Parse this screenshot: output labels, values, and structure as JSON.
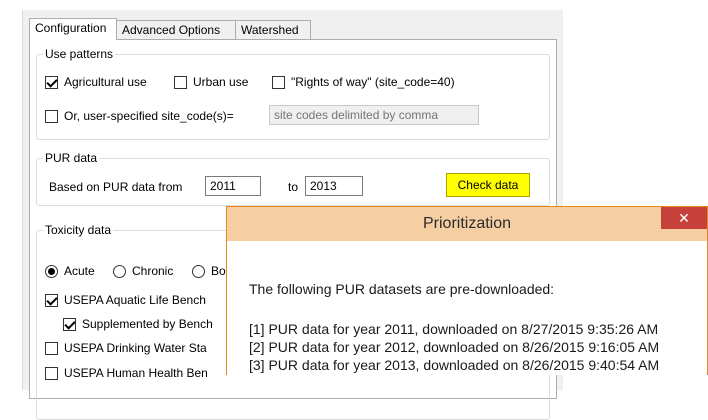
{
  "tabs": [
    {
      "label": "Configuration",
      "active": true
    },
    {
      "label": "Advanced Options",
      "active": false
    },
    {
      "label": "Watershed",
      "active": false
    }
  ],
  "use_patterns": {
    "title": "Use patterns",
    "agricultural": {
      "label": "Agricultural use",
      "checked": true
    },
    "urban": {
      "label": "Urban use",
      "checked": false
    },
    "rights_of_way": {
      "label": "\"Rights of way\" (site_code=40)",
      "checked": false
    },
    "user_specified": {
      "label": "Or, user-specified site_code(s)=",
      "checked": false
    },
    "site_codes_placeholder": "site codes delimited by comma"
  },
  "pur_data": {
    "title": "PUR data",
    "based_on_label": "Based on PUR data from",
    "from_year": "2011",
    "to_label": "to",
    "to_year": "2013",
    "check_button": "Check data",
    "check_button_color": "#ffff00"
  },
  "toxicity": {
    "title": "Toxicity data",
    "radio_acute": {
      "label": "Acute",
      "checked": true
    },
    "radio_chronic": {
      "label": "Chronic",
      "checked": false
    },
    "radio_third": {
      "label": "Bo",
      "checked": false
    },
    "usepa_aquatic": {
      "label": "USEPA Aquatic Life Bench",
      "checked": true
    },
    "supplemented": {
      "label": "Supplemented by Bench",
      "checked": true
    },
    "usepa_drinking": {
      "label": "USEPA Drinking Water Sta",
      "checked": false
    },
    "usepa_human": {
      "label": "USEPA Human Health Ben",
      "checked": false
    }
  },
  "dialog": {
    "title": "Prioritization",
    "close_glyph": "✕",
    "titlebar_color": "#f5cfa2",
    "close_color": "#c6413a",
    "message": "The following PUR datasets are pre-downloaded:",
    "lines": [
      "[1] PUR data for year 2011, downloaded on 8/27/2015 9:35:26 AM",
      "[2] PUR data for year 2012, downloaded on 8/26/2015 9:16:05 AM",
      "[3] PUR data for year 2013, downloaded on 8/26/2015 9:40:54 AM"
    ]
  }
}
